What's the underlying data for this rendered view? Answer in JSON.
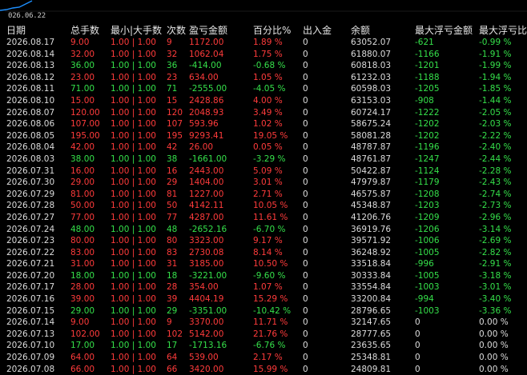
{
  "chart_strip": {
    "date_label": "026.06.22",
    "line_color": "#1e90ff"
  },
  "colors": {
    "profit": "#ff3b3b",
    "loss": "#35e04a",
    "neutral": "#dcdcdc"
  },
  "headers": [
    "日期",
    "总手数",
    "最小|大手数",
    "次数",
    "盈亏金额",
    "百分比%",
    "出入金",
    "余额",
    "最大浮亏金额",
    "最大浮亏比"
  ],
  "rows": [
    {
      "date": "2026.08.17",
      "lots": "9.00",
      "maxlots": "1.00 | 1.00",
      "count": "9",
      "pl": "1172.00",
      "pct": "1.89 %",
      "io": "0",
      "balance": "63052.07",
      "dd": "-621",
      "ddp": "-0.99 %",
      "dir": "up"
    },
    {
      "date": "2026.08.14",
      "lots": "32.00",
      "maxlots": "1.00 | 1.00",
      "count": "32",
      "pl": "1062.04",
      "pct": "1.75 %",
      "io": "0",
      "balance": "61880.07",
      "dd": "-1166",
      "ddp": "-1.91 %",
      "dir": "up"
    },
    {
      "date": "2026.08.13",
      "lots": "36.00",
      "maxlots": "1.00 | 1.00",
      "count": "36",
      "pl": "-414.00",
      "pct": "-0.68 %",
      "io": "0",
      "balance": "60818.03",
      "dd": "-1201",
      "ddp": "-1.99 %",
      "dir": "down"
    },
    {
      "date": "2026.08.12",
      "lots": "23.00",
      "maxlots": "1.00 | 1.00",
      "count": "23",
      "pl": "634.00",
      "pct": "1.05 %",
      "io": "0",
      "balance": "61232.03",
      "dd": "-1188",
      "ddp": "-1.94 %",
      "dir": "up"
    },
    {
      "date": "2026.08.11",
      "lots": "71.00",
      "maxlots": "1.00 | 1.00",
      "count": "71",
      "pl": "-2555.00",
      "pct": "-4.05 %",
      "io": "0",
      "balance": "60598.03",
      "dd": "-1205",
      "ddp": "-1.85 %",
      "dir": "down"
    },
    {
      "date": "2026.08.10",
      "lots": "15.00",
      "maxlots": "1.00 | 1.00",
      "count": "15",
      "pl": "2428.86",
      "pct": "4.00 %",
      "io": "0",
      "balance": "63153.03",
      "dd": "-908",
      "ddp": "-1.44 %",
      "dir": "up"
    },
    {
      "date": "2026.08.07",
      "lots": "120.00",
      "maxlots": "1.00 | 1.00",
      "count": "120",
      "pl": "2048.93",
      "pct": "3.49 %",
      "io": "0",
      "balance": "60724.17",
      "dd": "-1222",
      "ddp": "-2.05 %",
      "dir": "up"
    },
    {
      "date": "2026.08.06",
      "lots": "107.00",
      "maxlots": "1.00 | 1.00",
      "count": "107",
      "pl": "593.96",
      "pct": "1.02 %",
      "io": "0",
      "balance": "58675.24",
      "dd": "-1202",
      "ddp": "-2.03 %",
      "dir": "up"
    },
    {
      "date": "2026.08.05",
      "lots": "195.00",
      "maxlots": "1.00 | 1.00",
      "count": "195",
      "pl": "9293.41",
      "pct": "19.05 %",
      "io": "0",
      "balance": "58081.28",
      "dd": "-1202",
      "ddp": "-2.22 %",
      "dir": "up"
    },
    {
      "date": "2026.08.04",
      "lots": "42.00",
      "maxlots": "1.00 | 1.00",
      "count": "42",
      "pl": "26.00",
      "pct": "0.05 %",
      "io": "0",
      "balance": "48787.87",
      "dd": "-1196",
      "ddp": "-2.40 %",
      "dir": "up"
    },
    {
      "date": "2026.08.03",
      "lots": "38.00",
      "maxlots": "1.00 | 1.00",
      "count": "38",
      "pl": "-1661.00",
      "pct": "-3.29 %",
      "io": "0",
      "balance": "48761.87",
      "dd": "-1247",
      "ddp": "-2.44 %",
      "dir": "down"
    },
    {
      "date": "2026.07.31",
      "lots": "16.00",
      "maxlots": "1.00 | 1.00",
      "count": "16",
      "pl": "2443.00",
      "pct": "5.09 %",
      "io": "0",
      "balance": "50422.87",
      "dd": "-1124",
      "ddp": "-2.28 %",
      "dir": "up"
    },
    {
      "date": "2026.07.30",
      "lots": "29.00",
      "maxlots": "1.00 | 1.00",
      "count": "29",
      "pl": "1404.00",
      "pct": "3.01 %",
      "io": "0",
      "balance": "47979.87",
      "dd": "-1179",
      "ddp": "-2.43 %",
      "dir": "up"
    },
    {
      "date": "2026.07.29",
      "lots": "81.00",
      "maxlots": "1.00 | 1.00",
      "count": "81",
      "pl": "1227.00",
      "pct": "2.71 %",
      "io": "0",
      "balance": "46575.87",
      "dd": "-1208",
      "ddp": "-2.74 %",
      "dir": "up"
    },
    {
      "date": "2026.07.28",
      "lots": "50.00",
      "maxlots": "1.00 | 1.00",
      "count": "50",
      "pl": "4142.11",
      "pct": "10.05 %",
      "io": "0",
      "balance": "45348.87",
      "dd": "-1203",
      "ddp": "-2.73 %",
      "dir": "up"
    },
    {
      "date": "2026.07.27",
      "lots": "77.00",
      "maxlots": "1.00 | 1.00",
      "count": "77",
      "pl": "4287.00",
      "pct": "11.61 %",
      "io": "0",
      "balance": "41206.76",
      "dd": "-1209",
      "ddp": "-2.96 %",
      "dir": "up"
    },
    {
      "date": "2026.07.24",
      "lots": "48.00",
      "maxlots": "1.00 | 1.00",
      "count": "48",
      "pl": "-2652.16",
      "pct": "-6.70 %",
      "io": "0",
      "balance": "36919.76",
      "dd": "-1206",
      "ddp": "-3.14 %",
      "dir": "down"
    },
    {
      "date": "2026.07.23",
      "lots": "80.00",
      "maxlots": "1.00 | 1.00",
      "count": "80",
      "pl": "3323.00",
      "pct": "9.17 %",
      "io": "0",
      "balance": "39571.92",
      "dd": "-1006",
      "ddp": "-2.69 %",
      "dir": "up"
    },
    {
      "date": "2026.07.22",
      "lots": "83.00",
      "maxlots": "1.00 | 1.00",
      "count": "83",
      "pl": "2730.08",
      "pct": "8.14 %",
      "io": "0",
      "balance": "36248.92",
      "dd": "-1005",
      "ddp": "-2.82 %",
      "dir": "up"
    },
    {
      "date": "2026.07.21",
      "lots": "31.00",
      "maxlots": "1.00 | 1.00",
      "count": "31",
      "pl": "3185.00",
      "pct": "10.50 %",
      "io": "0",
      "balance": "33518.84",
      "dd": "-996",
      "ddp": "-2.91 %",
      "dir": "up"
    },
    {
      "date": "2026.07.20",
      "lots": "18.00",
      "maxlots": "1.00 | 1.00",
      "count": "18",
      "pl": "-3221.00",
      "pct": "-9.60 %",
      "io": "0",
      "balance": "30333.84",
      "dd": "-1005",
      "ddp": "-3.18 %",
      "dir": "down"
    },
    {
      "date": "2026.07.17",
      "lots": "28.00",
      "maxlots": "1.00 | 1.00",
      "count": "28",
      "pl": "354.00",
      "pct": "1.07 %",
      "io": "0",
      "balance": "33554.84",
      "dd": "-1003",
      "ddp": "-3.01 %",
      "dir": "up"
    },
    {
      "date": "2026.07.16",
      "lots": "39.00",
      "maxlots": "1.00 | 1.00",
      "count": "39",
      "pl": "4404.19",
      "pct": "15.29 %",
      "io": "0",
      "balance": "33200.84",
      "dd": "-994",
      "ddp": "-3.40 %",
      "dir": "up"
    },
    {
      "date": "2026.07.15",
      "lots": "29.00",
      "maxlots": "1.00 | 1.00",
      "count": "29",
      "pl": "-3351.00",
      "pct": "-10.42 %",
      "io": "0",
      "balance": "28796.65",
      "dd": "-1003",
      "ddp": "-3.36 %",
      "dir": "down"
    },
    {
      "date": "2026.07.14",
      "lots": "9.00",
      "maxlots": "1.00 | 1.00",
      "count": "9",
      "pl": "3370.00",
      "pct": "11.71 %",
      "io": "0",
      "balance": "32147.65",
      "dd": "0",
      "ddp": "0.00 %",
      "dir": "up"
    },
    {
      "date": "2026.07.13",
      "lots": "102.00",
      "maxlots": "1.00 | 1.00",
      "count": "102",
      "pl": "5142.00",
      "pct": "21.76 %",
      "io": "0",
      "balance": "28777.65",
      "dd": "0",
      "ddp": "0.00 %",
      "dir": "up"
    },
    {
      "date": "2026.07.10",
      "lots": "17.00",
      "maxlots": "1.00 | 1.00",
      "count": "17",
      "pl": "-1713.16",
      "pct": "-6.76 %",
      "io": "0",
      "balance": "23635.65",
      "dd": "0",
      "ddp": "0.00 %",
      "dir": "down"
    },
    {
      "date": "2026.07.09",
      "lots": "64.00",
      "maxlots": "1.00 | 1.00",
      "count": "64",
      "pl": "539.00",
      "pct": "2.17 %",
      "io": "0",
      "balance": "25348.81",
      "dd": "0",
      "ddp": "0.00 %",
      "dir": "up"
    },
    {
      "date": "2026.07.08",
      "lots": "66.00",
      "maxlots": "1.00 | 1.00",
      "count": "66",
      "pl": "3420.00",
      "pct": "15.99 %",
      "io": "0",
      "balance": "24809.81",
      "dd": "0",
      "ddp": "0.00 %",
      "dir": "up"
    }
  ]
}
